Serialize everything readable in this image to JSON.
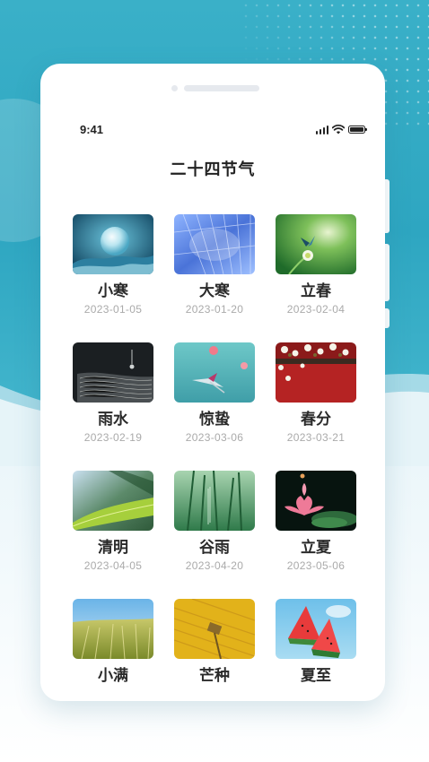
{
  "status": {
    "time": "9:41"
  },
  "title": "二十四节气",
  "terms": [
    {
      "name": "小寒",
      "date": "2023-01-05",
      "image": "frozen-bubble-photo"
    },
    {
      "name": "大寒",
      "date": "2023-01-20",
      "image": "blue-frost-feather-photo"
    },
    {
      "name": "立春",
      "date": "2023-02-04",
      "image": "butterfly-on-flower-photo"
    },
    {
      "name": "雨水",
      "date": "2023-02-19",
      "image": "water-drop-on-book-photo"
    },
    {
      "name": "惊蛰",
      "date": "2023-03-06",
      "image": "hummingbird-blossom-photo"
    },
    {
      "name": "春分",
      "date": "2023-03-21",
      "image": "red-wall-white-blossom-photo"
    },
    {
      "name": "清明",
      "date": "2023-04-05",
      "image": "green-leaf-closeup-photo"
    },
    {
      "name": "谷雨",
      "date": "2023-04-20",
      "image": "green-grass-rain-photo"
    },
    {
      "name": "立夏",
      "date": "2023-05-06",
      "image": "pink-lotus-photo"
    },
    {
      "name": "小满",
      "date": "",
      "image": "wheat-field-photo"
    },
    {
      "name": "芒种",
      "date": "",
      "image": "yellow-harvest-field-photo"
    },
    {
      "name": "夏至",
      "date": "",
      "image": "watermelon-slices-photo"
    }
  ],
  "colors": {
    "background_teal": "#2ea6c1",
    "card_white": "#ffffff",
    "title_text": "#222222",
    "date_text": "#aaaaaa"
  }
}
